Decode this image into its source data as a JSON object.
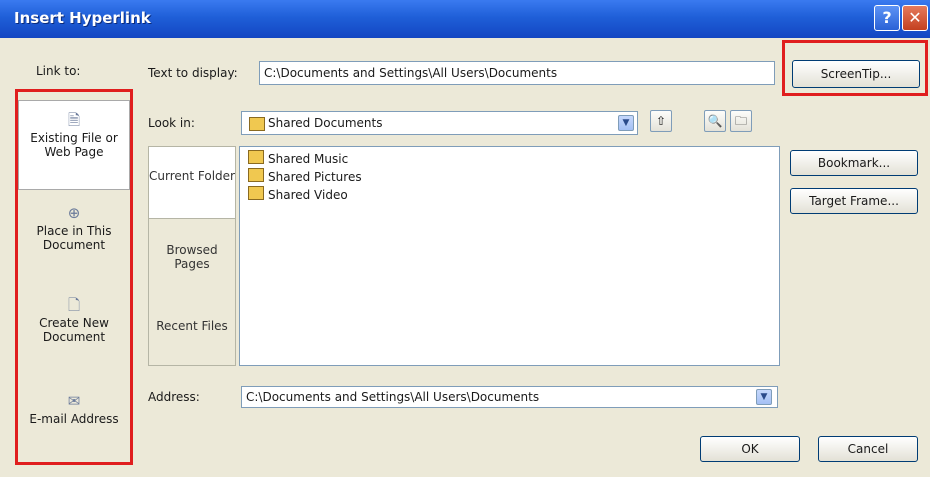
{
  "window": {
    "title": "Insert Hyperlink",
    "help_glyph": "?",
    "close_glyph": "✕"
  },
  "link_to": {
    "label": "Link to:",
    "items": [
      {
        "label": "Existing File or Web Page",
        "icon": "web-page-icon"
      },
      {
        "label": "Place in This Document",
        "icon": "place-in-document-icon"
      },
      {
        "label": "Create New Document",
        "icon": "new-document-icon"
      },
      {
        "label": "E-mail Address",
        "icon": "email-icon"
      }
    ]
  },
  "text_to_display": {
    "label": "Text to display:",
    "value": "C:\\Documents and Settings\\All Users\\Documents"
  },
  "look_in": {
    "label": "Look in:",
    "value": "Shared Documents"
  },
  "side_tabs": [
    {
      "label": "Current Folder"
    },
    {
      "label": "Browsed Pages"
    },
    {
      "label": "Recent Files"
    }
  ],
  "files": [
    {
      "name": "Shared Music",
      "icon": "folder-music-icon"
    },
    {
      "name": "Shared Pictures",
      "icon": "folder-pictures-icon"
    },
    {
      "name": "Shared Video",
      "icon": "folder-video-icon"
    }
  ],
  "address": {
    "label": "Address:",
    "value": "C:\\Documents and Settings\\All Users\\Documents"
  },
  "buttons": {
    "screentip": "ScreenTip...",
    "bookmark": "Bookmark...",
    "target_frame": "Target Frame...",
    "ok": "OK",
    "cancel": "Cancel"
  },
  "colors": {
    "title_bar": "#1f5fd8",
    "highlight_box": "#e01e1e",
    "dialog_bg": "#ece9d8"
  }
}
